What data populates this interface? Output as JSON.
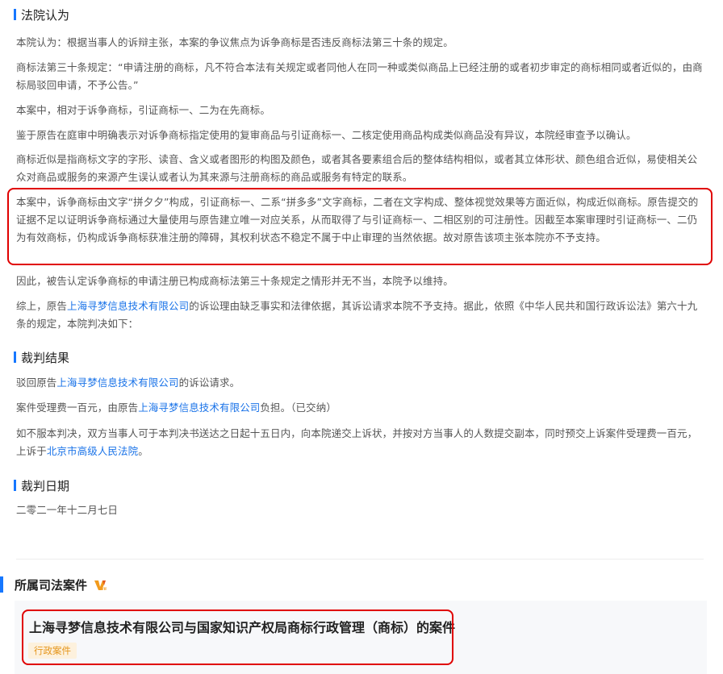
{
  "court_opinion": {
    "heading": "法院认为",
    "p1": "本院认为：根据当事人的诉辩主张，本案的争议焦点为诉争商标是否违反商标法第三十条的规定。",
    "p2": "商标法第三十条规定：“申请注册的商标，凡不符合本法有关规定或者同他人在同一种或类似商品上已经注册的或者初步审定的商标相同或者近似的，由商标局驳回申请，不予公告。”",
    "p3": "本案中，相对于诉争商标，引证商标一、二为在先商标。",
    "p4": "鉴于原告在庭审中明确表示对诉争商标指定使用的复审商品与引证商标一、二核定使用商品构成类似商品没有异议，本院经审查予以确认。",
    "p5": "商标近似是指商标文字的字形、读音、含义或者图形的构图及颜色，或者其各要素组合后的整体结构相似，或者其立体形状、颜色组合近似，易使相关公众对商品或服务的来源产生误认或者认为其来源与注册商标的商品或服务有特定的联系。",
    "p6": "本案中，诉争商标由文字“拼夕夕”构成，引证商标一、二系“拼多多”文字商标，二者在文字构成、整体视觉效果等方面近似，构成近似商标。原告提交的证据不足以证明诉争商标通过大量使用与原告建立唯一对应关系，从而取得了与引证商标一、二相区别的可注册性。因截至本案审理时引证商标一、二仍为有效商标，仍构成诉争商标获准注册的障碍，其权利状态不稳定不属于中止审理的当然依据。故对原告该项主张本院亦不予支持。",
    "p7": "因此，被告认定诉争商标的申请注册已构成商标法第三十条规定之情形并无不当，本院予以维持。",
    "p8_before": "综上，原告",
    "p8_link": "上海寻梦信息技术有限公司",
    "p8_after": "的诉讼理由缺乏事实和法律依据，其诉讼请求本院不予支持。据此，依照《中华人民共和国行政诉讼法》第六十九条的规定，本院判决如下："
  },
  "judgment_result": {
    "heading": "裁判结果",
    "r1_before": "驳回原告",
    "r1_link": "上海寻梦信息技术有限公司",
    "r1_after": "的诉讼请求。",
    "r2_before": "案件受理费一百元，由原告",
    "r2_link": "上海寻梦信息技术有限公司",
    "r2_after": "负担。（已交纳）",
    "r3_before": "如不服本判决，双方当事人可于本判决书送达之日起十五日内，向本院递交上诉状，并按对方当事人的人数提交副本，同时预交上诉案件受理费一百元，上诉于",
    "r3_link": "北京市高级人民法院",
    "r3_after": "。"
  },
  "judgment_date": {
    "heading": "裁判日期",
    "date": "二零二一年十二月七日"
  },
  "related_cases": {
    "heading": "所属司法案件",
    "vip_icon": "vip-badge-icon",
    "case_title": "上海寻梦信息技术有限公司与国家知识产权局商标行政管理（商标）的案件",
    "case_tag": "行政案件"
  },
  "colors": {
    "accent": "#1677ff",
    "link": "#1a73e8",
    "highlight_border": "#e00000",
    "tag_bg": "#fdf1dd",
    "tag_text": "#e5961d"
  }
}
